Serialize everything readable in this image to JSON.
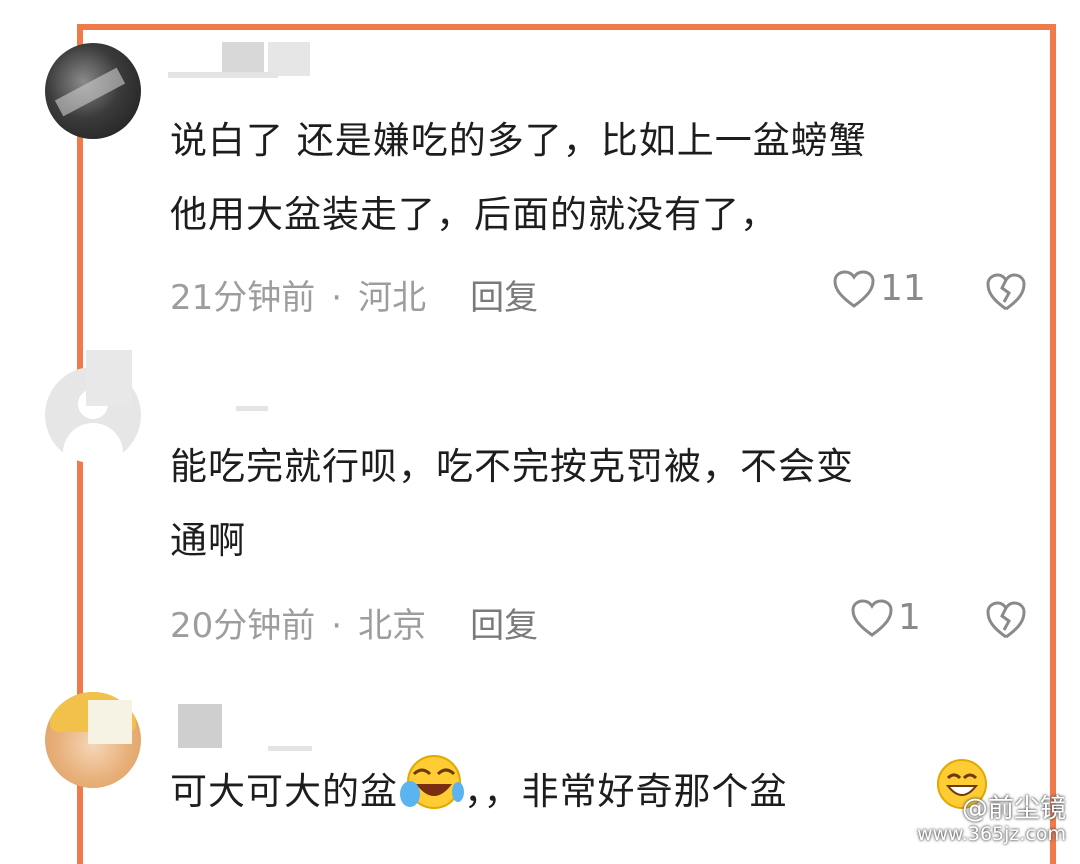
{
  "comments": [
    {
      "text": "说白了 还是嫌吃的多了，比如上一盆螃蟹\n他用大盆装走了，后面的就没有了，",
      "time": "21分钟前",
      "location": "河北",
      "reply_label": "回复",
      "likes": "11"
    },
    {
      "text": "能吃完就行呗，吃不完按克罚被，不会变\n通啊",
      "time": "20分钟前",
      "location": "北京",
      "reply_label": "回复",
      "likes": "1"
    },
    {
      "text_before_emoji": "可大可大的盆",
      "text_after_emoji": "，，非常好奇那个盆"
    }
  ],
  "watermark": {
    "text": "@前尘镜",
    "url": "www.365jz.com"
  },
  "colors": {
    "frame": "#f07a4a",
    "text": "#1d1d1d",
    "meta": "#9d9d9d"
  }
}
